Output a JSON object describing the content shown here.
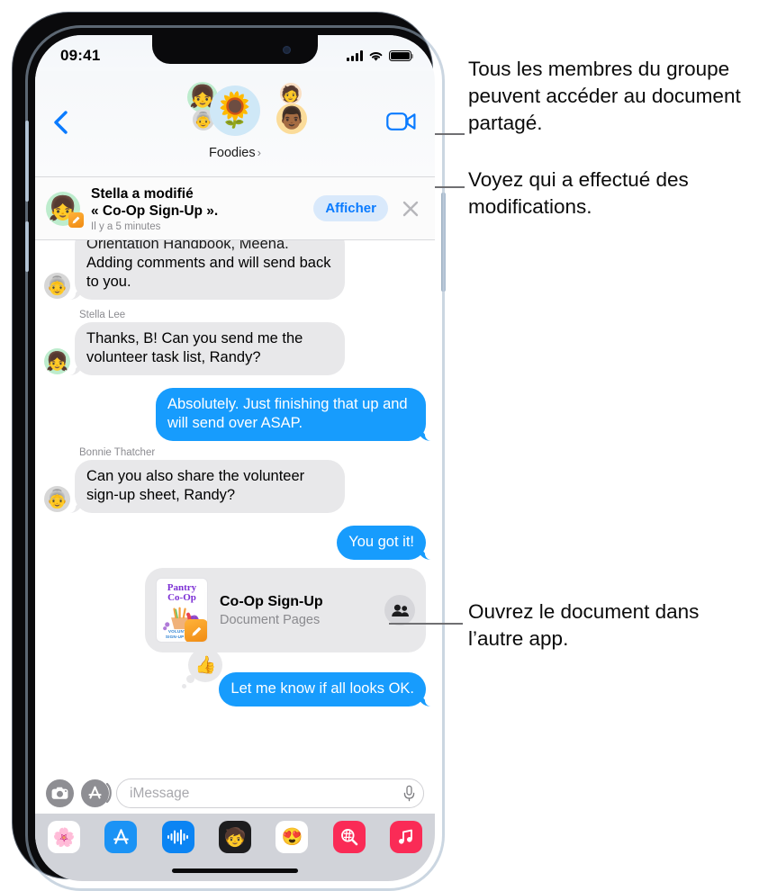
{
  "statusbar": {
    "time": "09:41",
    "signal_icon": "cellular-bars-icon",
    "wifi_icon": "wifi-icon",
    "battery_icon": "battery-icon"
  },
  "navbar": {
    "back_icon": "back-chevron-icon",
    "facetime_icon": "video-camera-icon",
    "group_name": "Foodies",
    "group_chevron": "›",
    "avatars": [
      {
        "name": "group-avatar-sunflower",
        "glyph": "🌻",
        "color": "#cfe8f7"
      },
      {
        "name": "member-avatar-stella",
        "glyph": "👧",
        "color": "#bdeccd"
      },
      {
        "name": "member-avatar-bonnie",
        "glyph": "👵",
        "color": "#d7d7d7"
      },
      {
        "name": "member-avatar-meena",
        "glyph": "🧑",
        "color": "#fadfc3"
      },
      {
        "name": "member-avatar-randy",
        "glyph": "👨🏾",
        "color": "#fbdc9a"
      }
    ]
  },
  "collab_banner": {
    "avatar_glyph": "👧",
    "pages_badge_icon": "pages-app-icon",
    "line1": "Stella a modifié",
    "line2": "« Co-Op Sign-Up ».",
    "timestamp": "Il y a 5 minutes",
    "view_button": "Afficher",
    "close_icon": "close-x-icon",
    "accent_color": "#0a7bff",
    "button_bg": "#d9e9fb"
  },
  "thread": {
    "messages": [
      {
        "id": "msg-clipped",
        "direction": "in",
        "sender": "",
        "clipped_text": "Orientation Handbook, Meena.",
        "text": "Adding comments and will send back to you.",
        "avatar_glyph": "👵",
        "avatar_color": "#d7d7d7"
      },
      {
        "id": "msg-stella-tasklist",
        "direction": "in",
        "sender": "Stella Lee",
        "text": "Thanks, B! Can you send me the volunteer task list, Randy?",
        "avatar_glyph": "👧",
        "avatar_color": "#bdeccd"
      },
      {
        "id": "msg-me-absolutely",
        "direction": "out",
        "sender": "",
        "text": "Absolutely. Just finishing that up and will send over ASAP.",
        "avatar_glyph": "",
        "avatar_color": ""
      },
      {
        "id": "msg-bonnie-signup",
        "direction": "in",
        "sender": "Bonnie Thatcher",
        "text": "Can you also share the volunteer sign-up sheet, Randy?",
        "avatar_glyph": "👵",
        "avatar_color": "#d7d7d7"
      },
      {
        "id": "msg-me-yougotit",
        "direction": "out",
        "sender": "",
        "text": "You got it!",
        "avatar_glyph": "",
        "avatar_color": ""
      }
    ],
    "document_card": {
      "title": "Co-Op Sign-Up",
      "subtitle": "Document Pages",
      "thumb_line1": "Pantry",
      "thumb_line2": "Co-Op",
      "thumb_footer1": "VOLUNTEER",
      "thumb_footer2": "SIGN-UP FORM",
      "people_icon": "people-group-icon",
      "pages_badge_icon": "pages-app-icon"
    },
    "last_message": {
      "id": "msg-me-looksok",
      "direction": "out",
      "text": "Let me know if all looks OK.",
      "tapback_icon": "thumbs-up-icon",
      "tapback_glyph": "👍"
    },
    "bubble_in_color": "#e8e8ea",
    "bubble_out_color": "#179cfd"
  },
  "inputbar": {
    "camera_icon": "camera-icon",
    "apps_icon": "app-store-messages-icon",
    "placeholder": "iMessage",
    "value": "",
    "mic_icon": "microphone-icon"
  },
  "app_drawer": {
    "apps": [
      {
        "name": "app-photos",
        "glyph": "🌸",
        "bg": "#ffffff"
      },
      {
        "name": "app-store",
        "glyph": "",
        "bg": "#1b93f5"
      },
      {
        "name": "app-audio",
        "glyph": "",
        "bg": "#0b84f3"
      },
      {
        "name": "app-memoji",
        "glyph": "🧒",
        "bg": "#1d1d1f"
      },
      {
        "name": "app-memoji-stickers",
        "glyph": "😍",
        "bg": "#ffffff"
      },
      {
        "name": "app-images-gif",
        "glyph": "",
        "bg": "#fa2b56"
      },
      {
        "name": "app-music",
        "glyph": "♫",
        "bg": "#fa2b56"
      }
    ],
    "home_indicator": "home-indicator"
  },
  "callouts": [
    {
      "id": "callout-shared-document",
      "text": "Tous les membres du groupe peuvent accéder au document partagé."
    },
    {
      "id": "callout-who-edited",
      "text": "Voyez qui a effectué des modifications."
    },
    {
      "id": "callout-open-in-app",
      "text": "Ouvrez le document dans l’autre app."
    }
  ]
}
